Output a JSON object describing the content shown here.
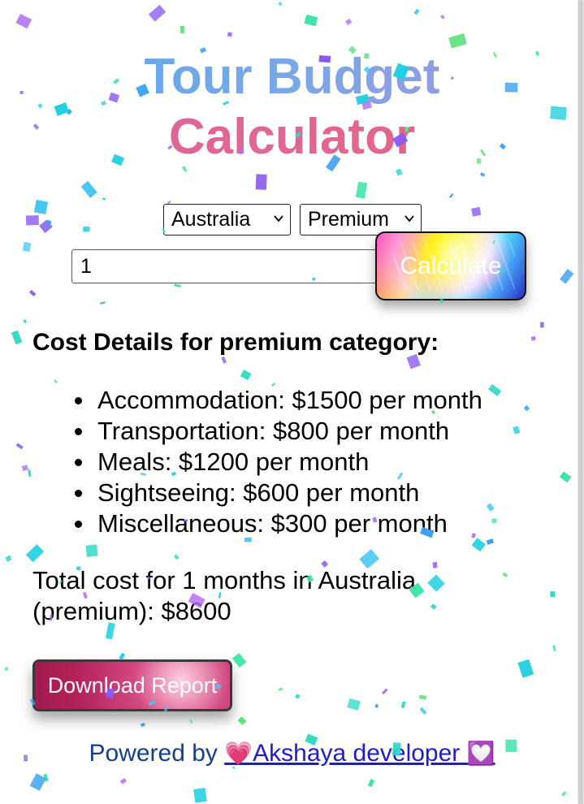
{
  "title": {
    "line1": "Tour Budget",
    "line2": "Calculator"
  },
  "form": {
    "country_selected": "Australia",
    "category_selected": "Premium",
    "months_value": "1",
    "calculate_label": "Calculate"
  },
  "results": {
    "heading": "Cost Details for premium category:",
    "items": [
      "Accommodation: $1500 per month",
      "Transportation: $800 per month",
      "Meals: $1200 per month",
      "Sightseeing: $600 per month",
      "Miscellaneous: $300 per month"
    ],
    "total_line1": "Total cost for 1 months in Australia",
    "total_line2": "(premium): $8600"
  },
  "download_label": "Download Report",
  "footer": {
    "prefix": "Powered by ",
    "heart_left": "💗",
    "link_text": "Akshaya developer ",
    "heart_right": "💟"
  },
  "icons": {
    "dropdown": "chevron-down-icon",
    "confetti": "confetti-overlay"
  },
  "colors": {
    "title_blue": "#57a7e8",
    "title_pink": "#e0678e",
    "footer_link": "#1f1bd0"
  }
}
